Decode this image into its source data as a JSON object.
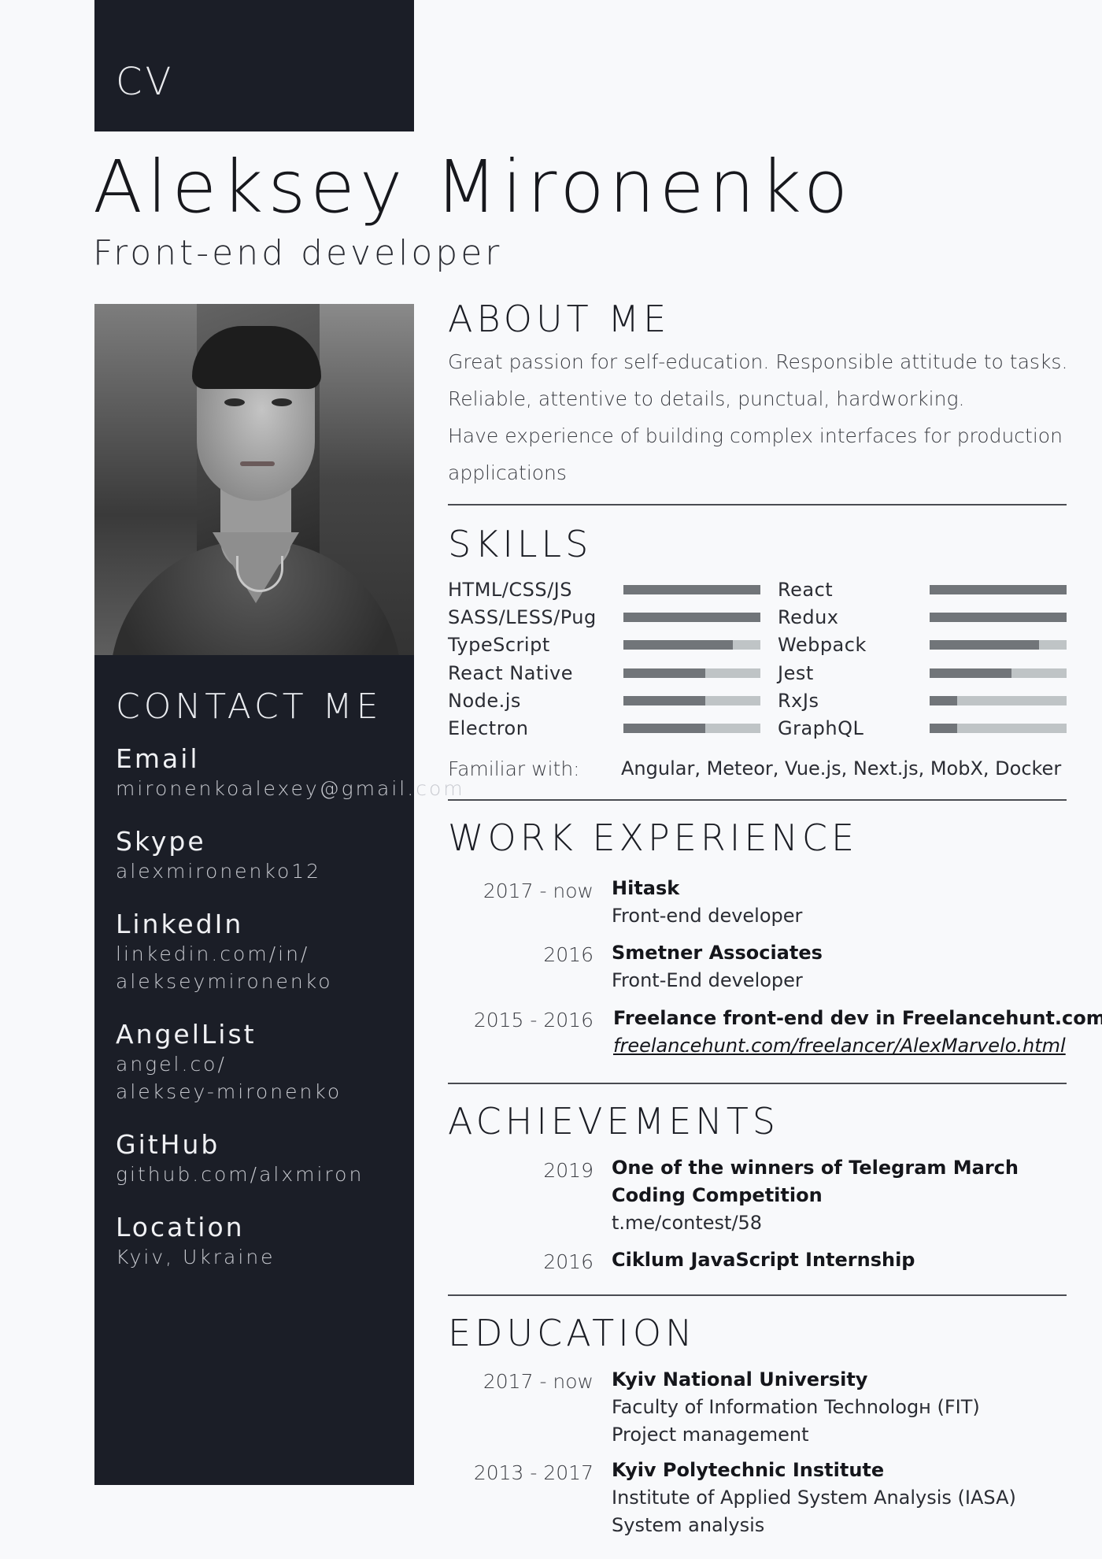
{
  "header": {
    "badge": "CV",
    "name": "Aleksey Mironenko",
    "role": "Front-end developer"
  },
  "contact": {
    "title": "CONTACT ME",
    "items": [
      {
        "label": "Email",
        "value": "mironenkoalexey@gmail.com"
      },
      {
        "label": "Skype",
        "value": "alexmironenko12"
      },
      {
        "label": "LinkedIn",
        "value_line1": "linkedin.com/in/",
        "value_line2": "alekseymironenko"
      },
      {
        "label": "AngelList",
        "value_line1": "angel.co/",
        "value_line2": "aleksey-mironenko"
      },
      {
        "label": "GitHub",
        "value": "github.com/alxmiron"
      },
      {
        "label": "Location",
        "value": "Kyiv, Ukraine"
      }
    ]
  },
  "about": {
    "title": "ABOUT ME",
    "lines": [
      "Great passion for self-education. Responsible attitude to tasks.",
      "Reliable, attentive to details, punctual, hardworking.",
      "Have experience of building complex interfaces for production",
      "applications"
    ]
  },
  "skills": {
    "title": "SKILLS",
    "left": [
      {
        "name": "HTML/CSS/JS",
        "level": 1.0
      },
      {
        "name": "SASS/LESS/Pug",
        "level": 1.0
      },
      {
        "name": "TypeScript",
        "level": 0.8
      },
      {
        "name": "React Native",
        "level": 0.6
      },
      {
        "name": "Node.js",
        "level": 0.6
      },
      {
        "name": "Electron",
        "level": 0.6
      }
    ],
    "right": [
      {
        "name": "React",
        "level": 1.0
      },
      {
        "name": "Redux",
        "level": 1.0
      },
      {
        "name": "Webpack",
        "level": 0.8
      },
      {
        "name": "Jest",
        "level": 0.6
      },
      {
        "name": "RxJs",
        "level": 0.2
      },
      {
        "name": "GraphQL",
        "level": 0.2
      }
    ],
    "familiar_label": "Familiar with:",
    "familiar_value": "Angular, Meteor, Vue.js, Next.js, MobX, Docker"
  },
  "work": {
    "title": "WORK EXPERIENCE",
    "entries": [
      {
        "date": "2017 - now",
        "title": "Hitask",
        "sub": "Front-end developer"
      },
      {
        "date": "2016",
        "title": "Smetner Associates",
        "sub": "Front-End developer"
      },
      {
        "date": "2015 - 2016",
        "title": "Freelance front-end dev in Freelancehunt.com",
        "link": "freelancehunt.com/freelancer/AlexMarvelo.html"
      }
    ]
  },
  "achievements": {
    "title": "ACHIEVEMENTS",
    "entries": [
      {
        "date": "2019",
        "title_line1": "One of the winners of Telegram March",
        "title_line2": "Coding Competition",
        "sub": "t.me/contest/58"
      },
      {
        "date": "2016",
        "title": "Ciklum JavaScript Internship"
      }
    ]
  },
  "education": {
    "title": "EDUCATION",
    "entries": [
      {
        "date": "2017 - now",
        "title": "Kyiv National University",
        "sub1": "Faculty of Information Technologн (FIT)",
        "sub2": "Project management"
      },
      {
        "date": "2013 - 2017",
        "title": "Kyiv Polytechnic Institute",
        "sub1": "Institute of Applied System Analysis (IASA)",
        "sub2": "System analysis"
      }
    ]
  },
  "colors": {
    "sidebar": "#1b1e27",
    "bar_fill": "#717579",
    "bar_track": "#bfc4c6",
    "page_bg": "#f8f9fb"
  }
}
